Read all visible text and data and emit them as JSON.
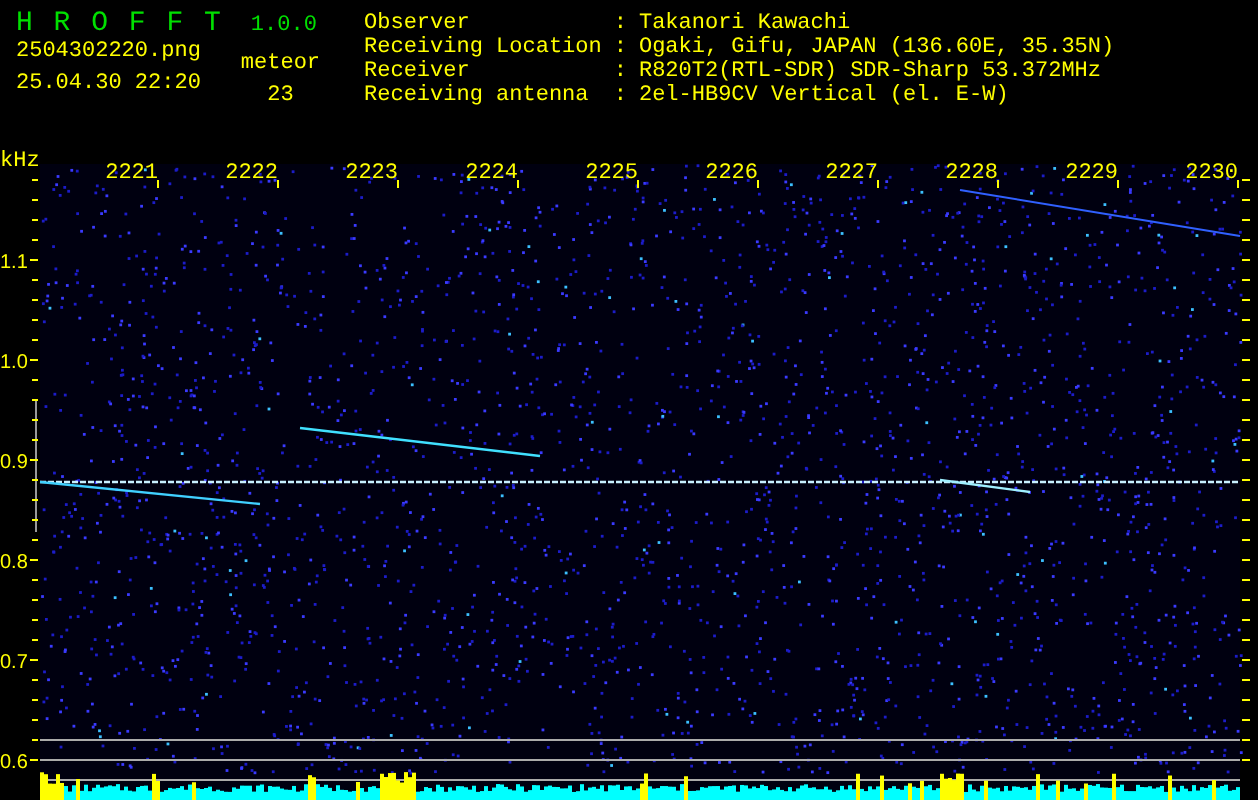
{
  "header": {
    "app_title": "H R O F F T",
    "version": "1.0.0",
    "file_name": "2504302220.png",
    "timestamp": "25.04.30 22:20",
    "count_label": "meteor",
    "count": "23"
  },
  "info": [
    {
      "label": "Observer",
      "separator": ":",
      "value": "Takanori Kawachi"
    },
    {
      "label": "Receiving Location",
      "separator": ":",
      "value": "Ogaki, Gifu, JAPAN (136.60E, 35.35N)"
    },
    {
      "label": "Receiver",
      "separator": ":",
      "value": "R820T2(RTL-SDR) SDR-Sharp 53.372MHz"
    },
    {
      "label": "Receiving antenna",
      "separator": ":",
      "value": "2el-HB9CV Vertical (el. E-W)"
    }
  ],
  "spectrogram": {
    "unit": "kHz",
    "time_labels": [
      "2221",
      "2222",
      "2223",
      "2224",
      "2225",
      "2226",
      "2227",
      "2228",
      "2229",
      "2230"
    ],
    "freq_labels": [
      "1.1",
      "1.0",
      "0.9",
      "0.8",
      "0.7",
      "0.6"
    ]
  }
}
